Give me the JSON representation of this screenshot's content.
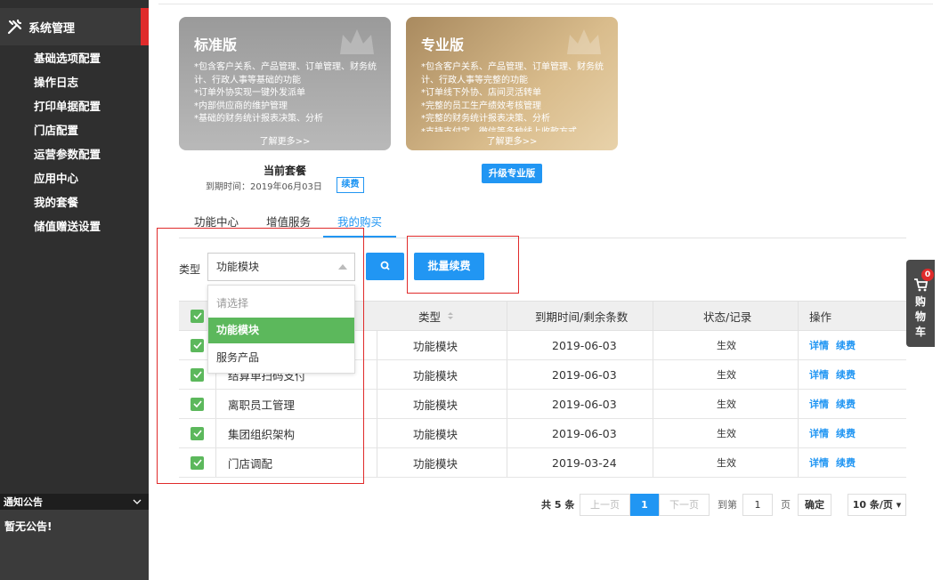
{
  "sidebar": {
    "header": "系统管理",
    "items": [
      "基础选项配置",
      "操作日志",
      "打印单据配置",
      "门店配置",
      "运营参数配置",
      "应用中心",
      "我的套餐",
      "储值赠送设置"
    ],
    "notice_title": "通知公告",
    "notice_body": "暂无公告!"
  },
  "plans": {
    "standard": {
      "title": "标准版",
      "lines": [
        "*包含客户关系、产品管理、订单管理、财务统计、行政人事等基础的功能",
        "*订单外协实现一键外发派单",
        "*内部供应商的维护管理",
        "*基础的财务统计报表决策、分析"
      ],
      "more": "了解更多>>"
    },
    "pro": {
      "title": "专业版",
      "lines": [
        "*包含客户关系、产品管理、订单管理、财务统计、行政人事等完整的功能",
        "*订单线下外协、店间灵活转单",
        "*完整的员工生产绩效考核管理",
        "*完整的财务统计报表决策、分析",
        "*支持支付宝、微信等多种线上收款方式"
      ],
      "more": "了解更多>>"
    },
    "current_label": "当前套餐",
    "expiry": "到期时间：2019年06月03日",
    "renew": "续费",
    "upgrade": "升级专业版"
  },
  "tabs": [
    "功能中心",
    "增值服务",
    "我的购买"
  ],
  "filter": {
    "label": "类型",
    "value": "功能模块",
    "options": [
      "请选择",
      "功能模块",
      "服务产品"
    ],
    "batch_renew": "批量续费"
  },
  "table": {
    "headers": [
      "类型",
      "到期时间/剩余条数",
      "状态/记录",
      "操作"
    ],
    "rows": [
      {
        "name": "",
        "type": "功能模块",
        "date": "2019-06-03",
        "status": "生效"
      },
      {
        "name": "结算单扫码支付",
        "type": "功能模块",
        "date": "2019-06-03",
        "status": "生效"
      },
      {
        "name": "离职员工管理",
        "type": "功能模块",
        "date": "2019-06-03",
        "status": "生效"
      },
      {
        "name": "集团组织架构",
        "type": "功能模块",
        "date": "2019-06-03",
        "status": "生效"
      },
      {
        "name": "门店调配",
        "type": "功能模块",
        "date": "2019-03-24",
        "status": "生效"
      }
    ],
    "detail": "详情",
    "renew": "续费"
  },
  "pager": {
    "total": "共 5 条",
    "prev": "上一页",
    "page": "1",
    "next": "下一页",
    "goto": "到第",
    "goto_val": "1",
    "page_unit": "页",
    "confirm": "确定",
    "size": "10 条/页"
  },
  "cart": {
    "label": "购物车",
    "count": "0"
  }
}
